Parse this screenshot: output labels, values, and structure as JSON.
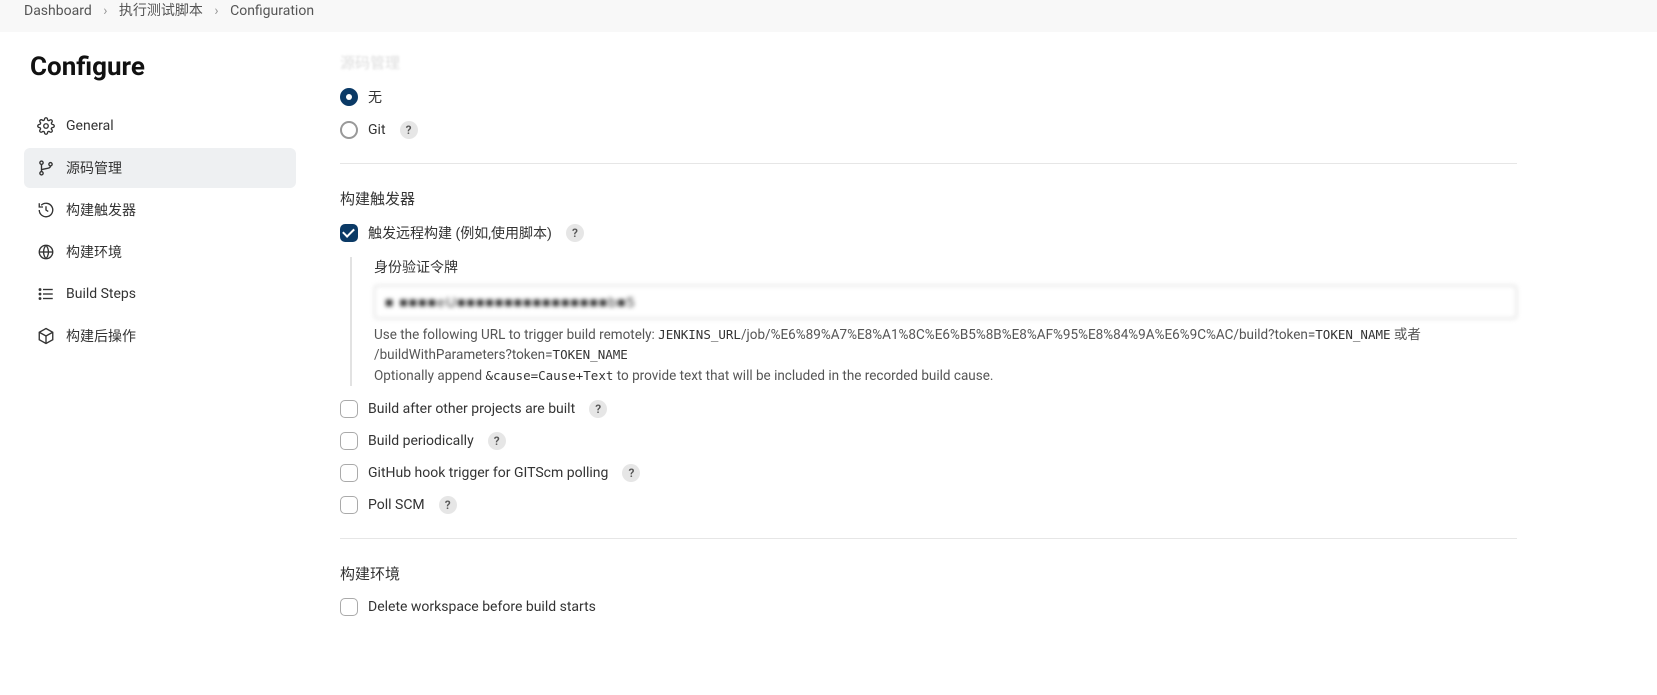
{
  "breadcrumb": {
    "items": [
      "Dashboard",
      "执行测试脚本",
      "Configuration"
    ]
  },
  "sidebar": {
    "title": "Configure",
    "items": [
      {
        "label": "General"
      },
      {
        "label": "源码管理"
      },
      {
        "label": "构建触发器"
      },
      {
        "label": "构建环境"
      },
      {
        "label": "Build Steps"
      },
      {
        "label": "构建后操作"
      }
    ]
  },
  "main": {
    "faded_section": "源码管理",
    "scm": {
      "none_label": "无",
      "git_label": "Git"
    },
    "triggers": {
      "title": "构建触发器",
      "remote_label": "触发远程构建 (例如,使用脚本)",
      "token_label": "身份验证令牌",
      "token_value": "■ ■■■■eU■■■■■■■■■■■■■■■■b■5",
      "url_help_prefix": "Use the following URL to trigger build remotely: ",
      "url_code_1": "JENKINS_URL",
      "url_text_1": "/job/%E6%89%A7%E8%A1%8C%E6%B5%8B%E8%AF%95%E8%84%9A%E6%9C%AC/build?token=",
      "url_code_2": "TOKEN_NAME",
      "url_text_2": " 或者 /buildWithParameters?token=",
      "url_code_3": "TOKEN_NAME",
      "append_prefix": "Optionally append ",
      "append_code": "&cause=Cause+Text",
      "append_suffix": " to provide text that will be included in the recorded build cause.",
      "build_after_label": "Build after other projects are built",
      "periodic_label": "Build periodically",
      "github_hook_label": "GitHub hook trigger for GITScm polling",
      "poll_scm_label": "Poll SCM"
    },
    "env": {
      "title": "构建环境",
      "delete_ws_label": "Delete workspace before build starts"
    }
  }
}
